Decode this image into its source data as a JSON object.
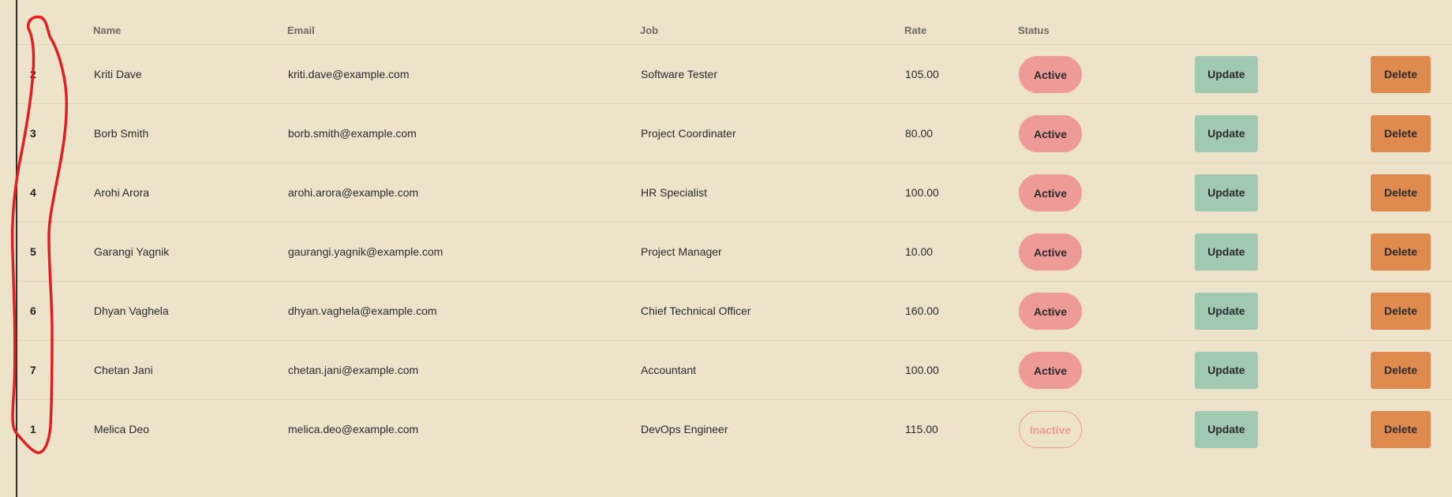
{
  "colors": {
    "background": "#ede3cb",
    "active_status": "#ee9a97",
    "update_button": "#a1c9b2",
    "delete_button": "#df8a4f",
    "annotation_stroke": "#e02020"
  },
  "table": {
    "headers": {
      "id": "",
      "name": "Name",
      "email": "Email",
      "job": "Job",
      "rate": "Rate",
      "status": "Status"
    },
    "rows": [
      {
        "id": "2",
        "name": "Kriti Dave",
        "email": "kriti.dave@example.com",
        "job": "Software Tester",
        "rate": "105.00",
        "status": "Active",
        "update": "Update",
        "delete": "Delete"
      },
      {
        "id": "3",
        "name": "Borb Smith",
        "email": "borb.smith@example.com",
        "job": "Project Coordinater",
        "rate": "80.00",
        "status": "Active",
        "update": "Update",
        "delete": "Delete"
      },
      {
        "id": "4",
        "name": "Arohi Arora",
        "email": "arohi.arora@example.com",
        "job": "HR Specialist",
        "rate": "100.00",
        "status": "Active",
        "update": "Update",
        "delete": "Delete"
      },
      {
        "id": "5",
        "name": "Garangi Yagnik",
        "email": "gaurangi.yagnik@example.com",
        "job": "Project Manager",
        "rate": "10.00",
        "status": "Active",
        "update": "Update",
        "delete": "Delete"
      },
      {
        "id": "6",
        "name": "Dhyan Vaghela",
        "email": "dhyan.vaghela@example.com",
        "job": "Chief Technical Officer",
        "rate": "160.00",
        "status": "Active",
        "update": "Update",
        "delete": "Delete"
      },
      {
        "id": "7",
        "name": "Chetan Jani",
        "email": "chetan.jani@example.com",
        "job": "Accountant",
        "rate": "100.00",
        "status": "Active",
        "update": "Update",
        "delete": "Delete"
      },
      {
        "id": "1",
        "name": "Melica Deo",
        "email": "melica.deo@example.com",
        "job": "DevOps Engineer",
        "rate": "115.00",
        "status": "Inactive",
        "update": "Update",
        "delete": "Delete"
      }
    ]
  }
}
